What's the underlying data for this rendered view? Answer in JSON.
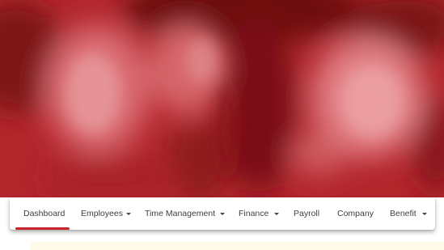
{
  "colors": {
    "accent": "#c8262b",
    "hero_dark": "#6e0c0f",
    "hero_mid": "#b3262c",
    "hero_light": "#e2898d",
    "nav_text": "#3f3f3f",
    "notice_bg": "#fdfbe7"
  },
  "nav": {
    "items": [
      {
        "label": "Dashboard",
        "active": true,
        "dropdown": false
      },
      {
        "label": "Employees",
        "active": false,
        "dropdown": true
      },
      {
        "label": "Time Management",
        "active": false,
        "dropdown": true
      },
      {
        "label": "Finance",
        "active": false,
        "dropdown": true
      },
      {
        "label": "Payroll",
        "active": false,
        "dropdown": false
      },
      {
        "label": "Company",
        "active": false,
        "dropdown": false
      },
      {
        "label": "Benefit",
        "active": false,
        "dropdown": true
      }
    ],
    "caret_icon": "caret-down-icon"
  }
}
